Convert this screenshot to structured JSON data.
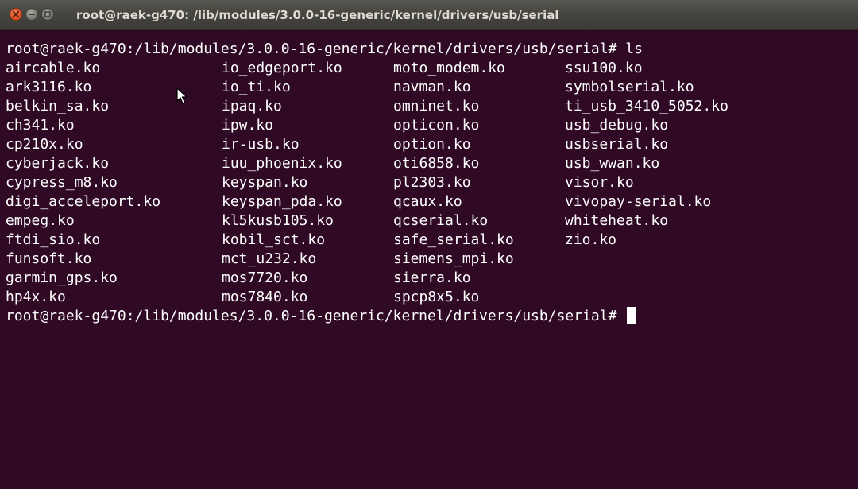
{
  "window": {
    "title": "root@raek-g470: /lib/modules/3.0.0-16-generic/kernel/drivers/usb/serial"
  },
  "terminal": {
    "colors": {
      "background": "#300a24",
      "foreground": "#ffffff"
    },
    "command_line": {
      "prompt": "root@raek-g470:/lib/modules/3.0.0-16-generic/kernel/drivers/usb/serial#",
      "command": "ls"
    },
    "listing": [
      [
        "aircable.ko",
        "io_edgeport.ko",
        "moto_modem.ko",
        "ssu100.ko"
      ],
      [
        "ark3116.ko",
        "io_ti.ko",
        "navman.ko",
        "symbolserial.ko"
      ],
      [
        "belkin_sa.ko",
        "ipaq.ko",
        "omninet.ko",
        "ti_usb_3410_5052.ko"
      ],
      [
        "ch341.ko",
        "ipw.ko",
        "opticon.ko",
        "usb_debug.ko"
      ],
      [
        "cp210x.ko",
        "ir-usb.ko",
        "option.ko",
        "usbserial.ko"
      ],
      [
        "cyberjack.ko",
        "iuu_phoenix.ko",
        "oti6858.ko",
        "usb_wwan.ko"
      ],
      [
        "cypress_m8.ko",
        "keyspan.ko",
        "pl2303.ko",
        "visor.ko"
      ],
      [
        "digi_acceleport.ko",
        "keyspan_pda.ko",
        "qcaux.ko",
        "vivopay-serial.ko"
      ],
      [
        "empeg.ko",
        "kl5kusb105.ko",
        "qcserial.ko",
        "whiteheat.ko"
      ],
      [
        "ftdi_sio.ko",
        "kobil_sct.ko",
        "safe_serial.ko",
        "zio.ko"
      ],
      [
        "funsoft.ko",
        "mct_u232.ko",
        "siemens_mpi.ko",
        ""
      ],
      [
        "garmin_gps.ko",
        "mos7720.ko",
        "sierra.ko",
        ""
      ],
      [
        "hp4x.ko",
        "mos7840.ko",
        "spcp8x5.ko",
        ""
      ]
    ],
    "final_prompt": "root@raek-g470:/lib/modules/3.0.0-16-generic/kernel/drivers/usb/serial#"
  },
  "icons": {
    "close": "close-icon",
    "minimize": "minimize-icon",
    "maximize": "maximize-icon",
    "pointer": "mouse-pointer-icon"
  }
}
